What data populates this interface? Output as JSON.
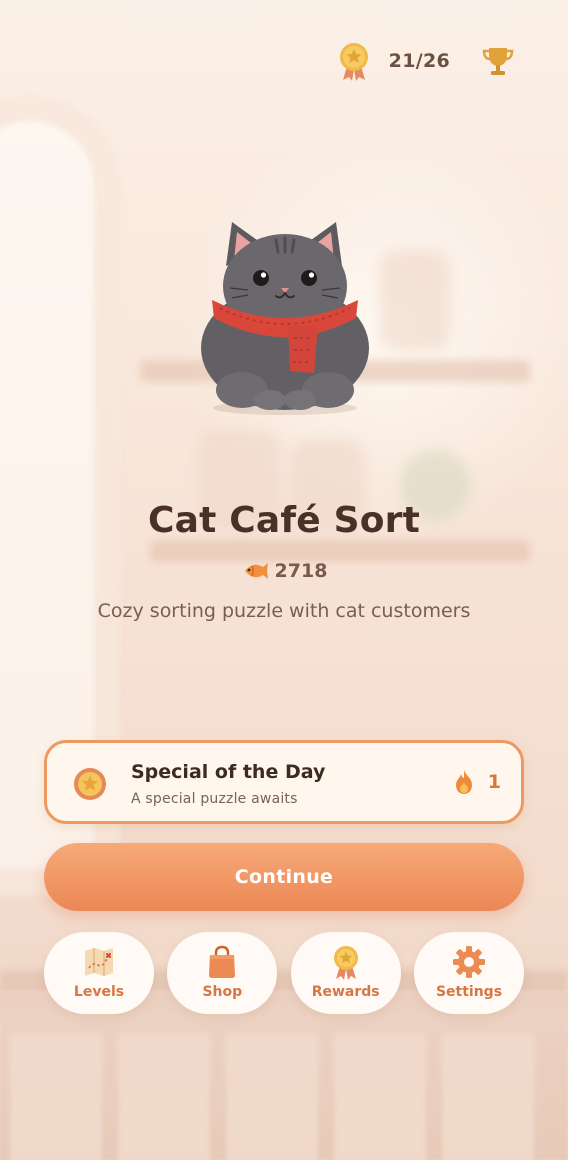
{
  "header": {
    "progress": "21/26",
    "medal_icon": "medal-icon",
    "trophy_icon": "trophy-icon"
  },
  "game": {
    "title": "Cat Café Sort",
    "coins": "2718",
    "coin_icon": "fish-icon",
    "tagline": "Cozy sorting puzzle with cat customers"
  },
  "special": {
    "title": "Special of the Day",
    "subtitle": "A special puzzle awaits",
    "streak": "1",
    "badge_icon": "star-badge-icon",
    "streak_icon": "flame-icon"
  },
  "actions": {
    "continue_label": "Continue"
  },
  "nav": [
    {
      "label": "Levels",
      "icon": "map-icon"
    },
    {
      "label": "Shop",
      "icon": "shopping-bag-icon"
    },
    {
      "label": "Rewards",
      "icon": "medal-icon"
    },
    {
      "label": "Settings",
      "icon": "gear-icon"
    }
  ],
  "colors": {
    "accent": "#ec8756",
    "title": "#4a3128",
    "background": "#f6e6da"
  }
}
